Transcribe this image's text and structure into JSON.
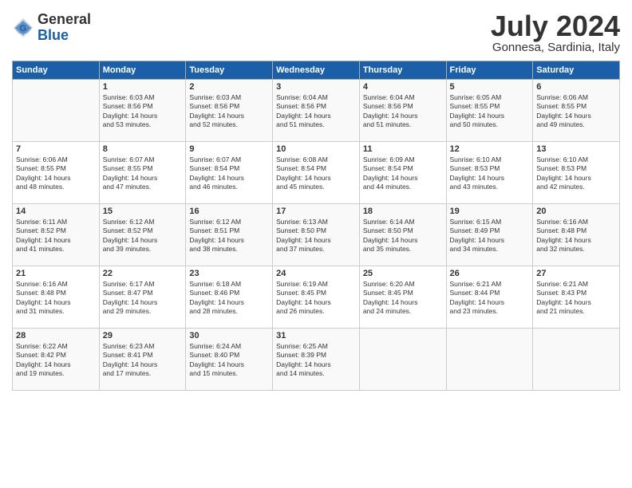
{
  "header": {
    "logo_line1": "General",
    "logo_line2": "Blue",
    "title": "July 2024",
    "location": "Gonnesa, Sardinia, Italy"
  },
  "days_of_week": [
    "Sunday",
    "Monday",
    "Tuesday",
    "Wednesday",
    "Thursday",
    "Friday",
    "Saturday"
  ],
  "weeks": [
    [
      {
        "day": "",
        "info": ""
      },
      {
        "day": "1",
        "info": "Sunrise: 6:03 AM\nSunset: 8:56 PM\nDaylight: 14 hours\nand 53 minutes."
      },
      {
        "day": "2",
        "info": "Sunrise: 6:03 AM\nSunset: 8:56 PM\nDaylight: 14 hours\nand 52 minutes."
      },
      {
        "day": "3",
        "info": "Sunrise: 6:04 AM\nSunset: 8:56 PM\nDaylight: 14 hours\nand 51 minutes."
      },
      {
        "day": "4",
        "info": "Sunrise: 6:04 AM\nSunset: 8:56 PM\nDaylight: 14 hours\nand 51 minutes."
      },
      {
        "day": "5",
        "info": "Sunrise: 6:05 AM\nSunset: 8:55 PM\nDaylight: 14 hours\nand 50 minutes."
      },
      {
        "day": "6",
        "info": "Sunrise: 6:06 AM\nSunset: 8:55 PM\nDaylight: 14 hours\nand 49 minutes."
      }
    ],
    [
      {
        "day": "7",
        "info": "Sunrise: 6:06 AM\nSunset: 8:55 PM\nDaylight: 14 hours\nand 48 minutes."
      },
      {
        "day": "8",
        "info": "Sunrise: 6:07 AM\nSunset: 8:55 PM\nDaylight: 14 hours\nand 47 minutes."
      },
      {
        "day": "9",
        "info": "Sunrise: 6:07 AM\nSunset: 8:54 PM\nDaylight: 14 hours\nand 46 minutes."
      },
      {
        "day": "10",
        "info": "Sunrise: 6:08 AM\nSunset: 8:54 PM\nDaylight: 14 hours\nand 45 minutes."
      },
      {
        "day": "11",
        "info": "Sunrise: 6:09 AM\nSunset: 8:54 PM\nDaylight: 14 hours\nand 44 minutes."
      },
      {
        "day": "12",
        "info": "Sunrise: 6:10 AM\nSunset: 8:53 PM\nDaylight: 14 hours\nand 43 minutes."
      },
      {
        "day": "13",
        "info": "Sunrise: 6:10 AM\nSunset: 8:53 PM\nDaylight: 14 hours\nand 42 minutes."
      }
    ],
    [
      {
        "day": "14",
        "info": "Sunrise: 6:11 AM\nSunset: 8:52 PM\nDaylight: 14 hours\nand 41 minutes."
      },
      {
        "day": "15",
        "info": "Sunrise: 6:12 AM\nSunset: 8:52 PM\nDaylight: 14 hours\nand 39 minutes."
      },
      {
        "day": "16",
        "info": "Sunrise: 6:12 AM\nSunset: 8:51 PM\nDaylight: 14 hours\nand 38 minutes."
      },
      {
        "day": "17",
        "info": "Sunrise: 6:13 AM\nSunset: 8:50 PM\nDaylight: 14 hours\nand 37 minutes."
      },
      {
        "day": "18",
        "info": "Sunrise: 6:14 AM\nSunset: 8:50 PM\nDaylight: 14 hours\nand 35 minutes."
      },
      {
        "day": "19",
        "info": "Sunrise: 6:15 AM\nSunset: 8:49 PM\nDaylight: 14 hours\nand 34 minutes."
      },
      {
        "day": "20",
        "info": "Sunrise: 6:16 AM\nSunset: 8:48 PM\nDaylight: 14 hours\nand 32 minutes."
      }
    ],
    [
      {
        "day": "21",
        "info": "Sunrise: 6:16 AM\nSunset: 8:48 PM\nDaylight: 14 hours\nand 31 minutes."
      },
      {
        "day": "22",
        "info": "Sunrise: 6:17 AM\nSunset: 8:47 PM\nDaylight: 14 hours\nand 29 minutes."
      },
      {
        "day": "23",
        "info": "Sunrise: 6:18 AM\nSunset: 8:46 PM\nDaylight: 14 hours\nand 28 minutes."
      },
      {
        "day": "24",
        "info": "Sunrise: 6:19 AM\nSunset: 8:45 PM\nDaylight: 14 hours\nand 26 minutes."
      },
      {
        "day": "25",
        "info": "Sunrise: 6:20 AM\nSunset: 8:45 PM\nDaylight: 14 hours\nand 24 minutes."
      },
      {
        "day": "26",
        "info": "Sunrise: 6:21 AM\nSunset: 8:44 PM\nDaylight: 14 hours\nand 23 minutes."
      },
      {
        "day": "27",
        "info": "Sunrise: 6:21 AM\nSunset: 8:43 PM\nDaylight: 14 hours\nand 21 minutes."
      }
    ],
    [
      {
        "day": "28",
        "info": "Sunrise: 6:22 AM\nSunset: 8:42 PM\nDaylight: 14 hours\nand 19 minutes."
      },
      {
        "day": "29",
        "info": "Sunrise: 6:23 AM\nSunset: 8:41 PM\nDaylight: 14 hours\nand 17 minutes."
      },
      {
        "day": "30",
        "info": "Sunrise: 6:24 AM\nSunset: 8:40 PM\nDaylight: 14 hours\nand 15 minutes."
      },
      {
        "day": "31",
        "info": "Sunrise: 6:25 AM\nSunset: 8:39 PM\nDaylight: 14 hours\nand 14 minutes."
      },
      {
        "day": "",
        "info": ""
      },
      {
        "day": "",
        "info": ""
      },
      {
        "day": "",
        "info": ""
      }
    ]
  ]
}
